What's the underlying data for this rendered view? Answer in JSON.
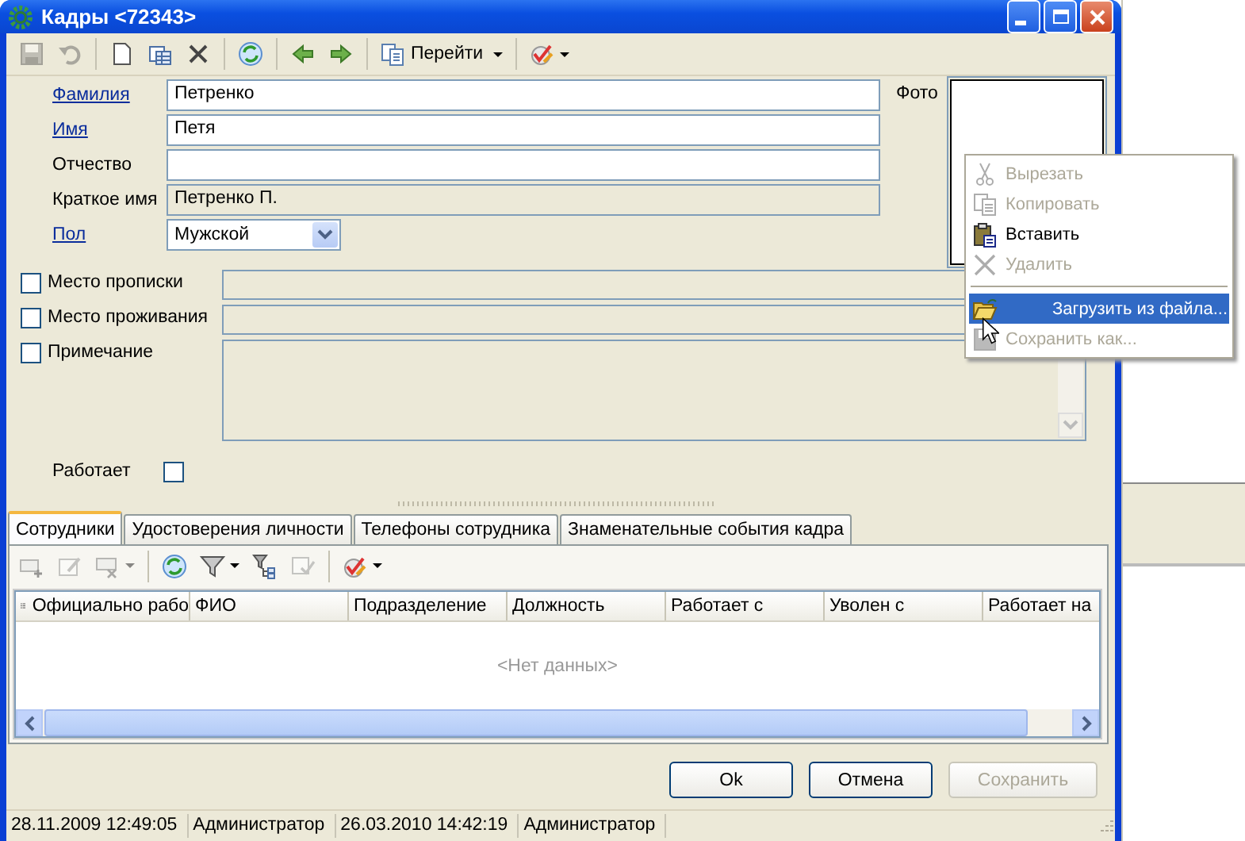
{
  "window": {
    "title": "Кадры <72343>"
  },
  "toolbar": {
    "groups": [
      [
        {
          "kind": "save",
          "disabled": true
        },
        {
          "kind": "undo",
          "disabled": true
        }
      ],
      [
        {
          "kind": "new",
          "disabled": false
        },
        {
          "kind": "table",
          "disabled": false
        },
        {
          "kind": "delete",
          "disabled": false
        }
      ],
      [
        {
          "kind": "refresh",
          "disabled": false
        }
      ],
      [
        {
          "kind": "back",
          "disabled": false
        },
        {
          "kind": "forward",
          "disabled": false
        }
      ],
      [
        {
          "kind": "goto",
          "label": "Перейти",
          "disabled": false,
          "dropdown": true
        }
      ],
      [
        {
          "kind": "check",
          "disabled": false,
          "dropdown": true
        }
      ]
    ]
  },
  "fields": [
    {
      "label": "Фамилия",
      "link": true,
      "kind": "text",
      "value": "Петренко"
    },
    {
      "label": "Имя",
      "link": true,
      "kind": "text",
      "value": "Петя"
    },
    {
      "label": "Отчество",
      "link": false,
      "kind": "text"
    },
    {
      "label": "Краткое имя",
      "link": false,
      "kind": "readonly",
      "value": "Петренко П."
    },
    {
      "label": "Пол",
      "link": true,
      "kind": "select",
      "value": "Мужской"
    }
  ],
  "photo": {
    "label": "Фото"
  },
  "optional_fields": [
    {
      "label": "Место прописки",
      "checked": false,
      "kind": "line"
    },
    {
      "label": "Место проживания",
      "checked": false,
      "kind": "line"
    },
    {
      "label": "Примечание",
      "checked": false,
      "kind": "memo"
    }
  ],
  "works": {
    "label": "Работает",
    "checked": false
  },
  "tabs": [
    {
      "label": "Сотрудники",
      "selected": true
    },
    {
      "label": "Удостоверения личности",
      "selected": false
    },
    {
      "label": "Телефоны сотрудника",
      "selected": false
    },
    {
      "label": "Знаменательные события кадра",
      "selected": false
    }
  ],
  "tab_toolbar": {
    "groups": [
      [
        {
          "kind": "add_row",
          "disabled": true
        },
        {
          "kind": "edit",
          "disabled": true
        },
        {
          "kind": "remove_row",
          "disabled": true,
          "dropdown": true
        }
      ],
      [
        {
          "kind": "refresh",
          "disabled": false
        },
        {
          "kind": "filter",
          "disabled": false,
          "dropdown": true
        },
        {
          "kind": "filter_tree",
          "disabled": false
        },
        {
          "kind": "table_check",
          "disabled": true
        }
      ],
      [
        {
          "kind": "check",
          "disabled": false,
          "dropdown": true
        }
      ]
    ]
  },
  "table": {
    "columns": [
      "Официально рабо",
      "ФИО",
      "Подразделение",
      "Должность",
      "Работает с",
      "Уволен с",
      "Работает на"
    ],
    "empty_text": "<Нет данных>"
  },
  "buttons": [
    {
      "label": "Ok",
      "disabled": false
    },
    {
      "label": "Отмена",
      "disabled": false
    },
    {
      "label": "Сохранить",
      "disabled": true
    }
  ],
  "status_bar": [
    "28.11.2009 12:49:05",
    "Администратор",
    "26.03.2010 14:42:19",
    "Администратор"
  ],
  "context_menu": [
    {
      "kind": "cut",
      "label": "Вырезать",
      "disabled": true,
      "selected": false
    },
    {
      "kind": "copy",
      "label": "Копировать",
      "disabled": true,
      "selected": false
    },
    {
      "kind": "paste",
      "label": "Вставить",
      "disabled": false,
      "selected": false
    },
    {
      "kind": "delete",
      "label": "Удалить",
      "disabled": true,
      "selected": false
    },
    {
      "kind": "separator"
    },
    {
      "kind": "open",
      "label": "Загрузить из файла...",
      "disabled": false,
      "selected": true
    },
    {
      "kind": "save",
      "label": "Сохранить как...",
      "disabled": true,
      "selected": false
    }
  ]
}
